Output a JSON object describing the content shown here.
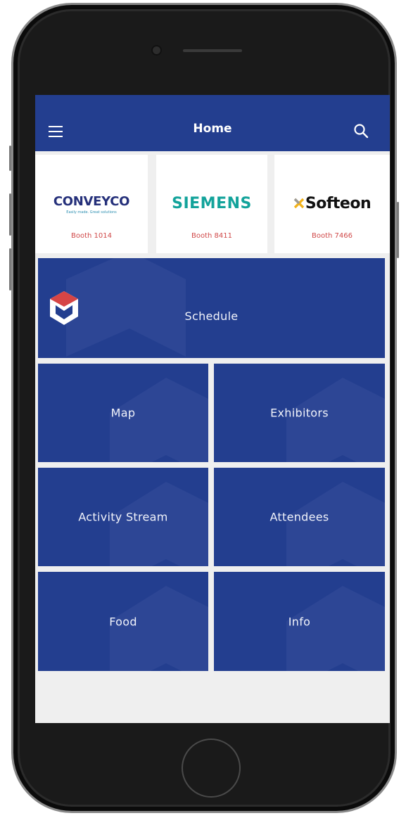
{
  "header": {
    "title": "Home"
  },
  "icons": {
    "menu": "hamburger-menu-icon",
    "search": "search-icon",
    "app_logo": "app-logo-icon"
  },
  "sponsors": [
    {
      "name": "CONVEYCO",
      "tagline": "Easily made. Great solutions",
      "booth": "Booth 1014"
    },
    {
      "name": "SIEMENS",
      "booth": "Booth 8411"
    },
    {
      "name": "Softeon",
      "booth": "Booth 7466"
    }
  ],
  "tiles": {
    "schedule": "Schedule",
    "map": "Map",
    "exhibitors": "Exhibitors",
    "activity_stream": "Activity Stream",
    "attendees": "Attendees",
    "food": "Food",
    "info": "Info"
  },
  "colors": {
    "primary": "#233e8f",
    "booth_text": "#d04949",
    "siemens": "#13a39b",
    "conveyco": "#25307a"
  }
}
